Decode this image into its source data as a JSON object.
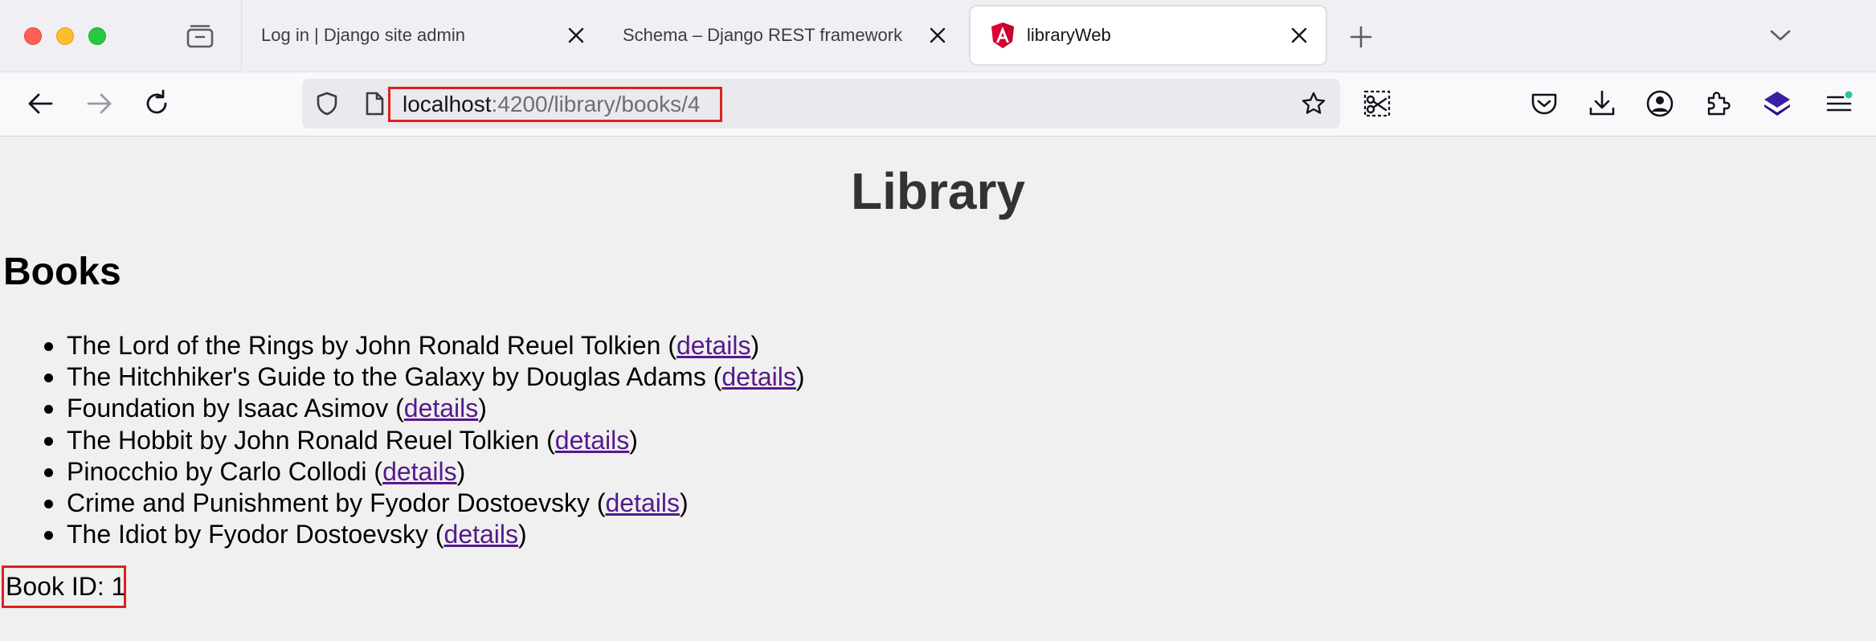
{
  "browser": {
    "tabs": [
      {
        "title": "Log in | Django site admin",
        "active": false
      },
      {
        "title": "Schema – Django REST framework",
        "active": false
      },
      {
        "title": "libraryWeb",
        "active": true
      }
    ],
    "url": {
      "host": "localhost",
      "path": ":4200/library/books/4"
    },
    "icons": {
      "back": "arrow-left-icon",
      "forward": "arrow-right-icon",
      "reload": "reload-icon",
      "shield": "shield-icon",
      "page": "page-icon",
      "bookmark": "star-icon",
      "screenshot": "scissors-icon",
      "pocket": "pocket-icon",
      "downloads": "download-icon",
      "account": "account-icon",
      "extensions": "puzzle-icon",
      "menu": "hamburger-menu-icon"
    },
    "colors": {
      "highlight_box": "#e0201b",
      "link": "#551a8b",
      "angular": "#dd0031"
    }
  },
  "page": {
    "title": "Library",
    "section_title": "Books",
    "books": [
      {
        "text": "The Lord of the Rings by John Ronald Reuel Tolkien (",
        "link": "details",
        "suffix": ")"
      },
      {
        "text": "The Hitchhiker's Guide to the Galaxy by Douglas Adams (",
        "link": "details",
        "suffix": ")"
      },
      {
        "text": "Foundation by Isaac Asimov (",
        "link": "details",
        "suffix": ")"
      },
      {
        "text": "The Hobbit by John Ronald Reuel Tolkien (",
        "link": "details",
        "suffix": ")"
      },
      {
        "text": "Pinocchio by Carlo Collodi (",
        "link": "details",
        "suffix": ")"
      },
      {
        "text": "Crime and Punishment by Fyodor Dostoevsky (",
        "link": "details",
        "suffix": ")"
      },
      {
        "text": "The Idiot by Fyodor Dostoevsky (",
        "link": "details",
        "suffix": ")"
      }
    ],
    "book_id_text": "Book ID: 1"
  }
}
